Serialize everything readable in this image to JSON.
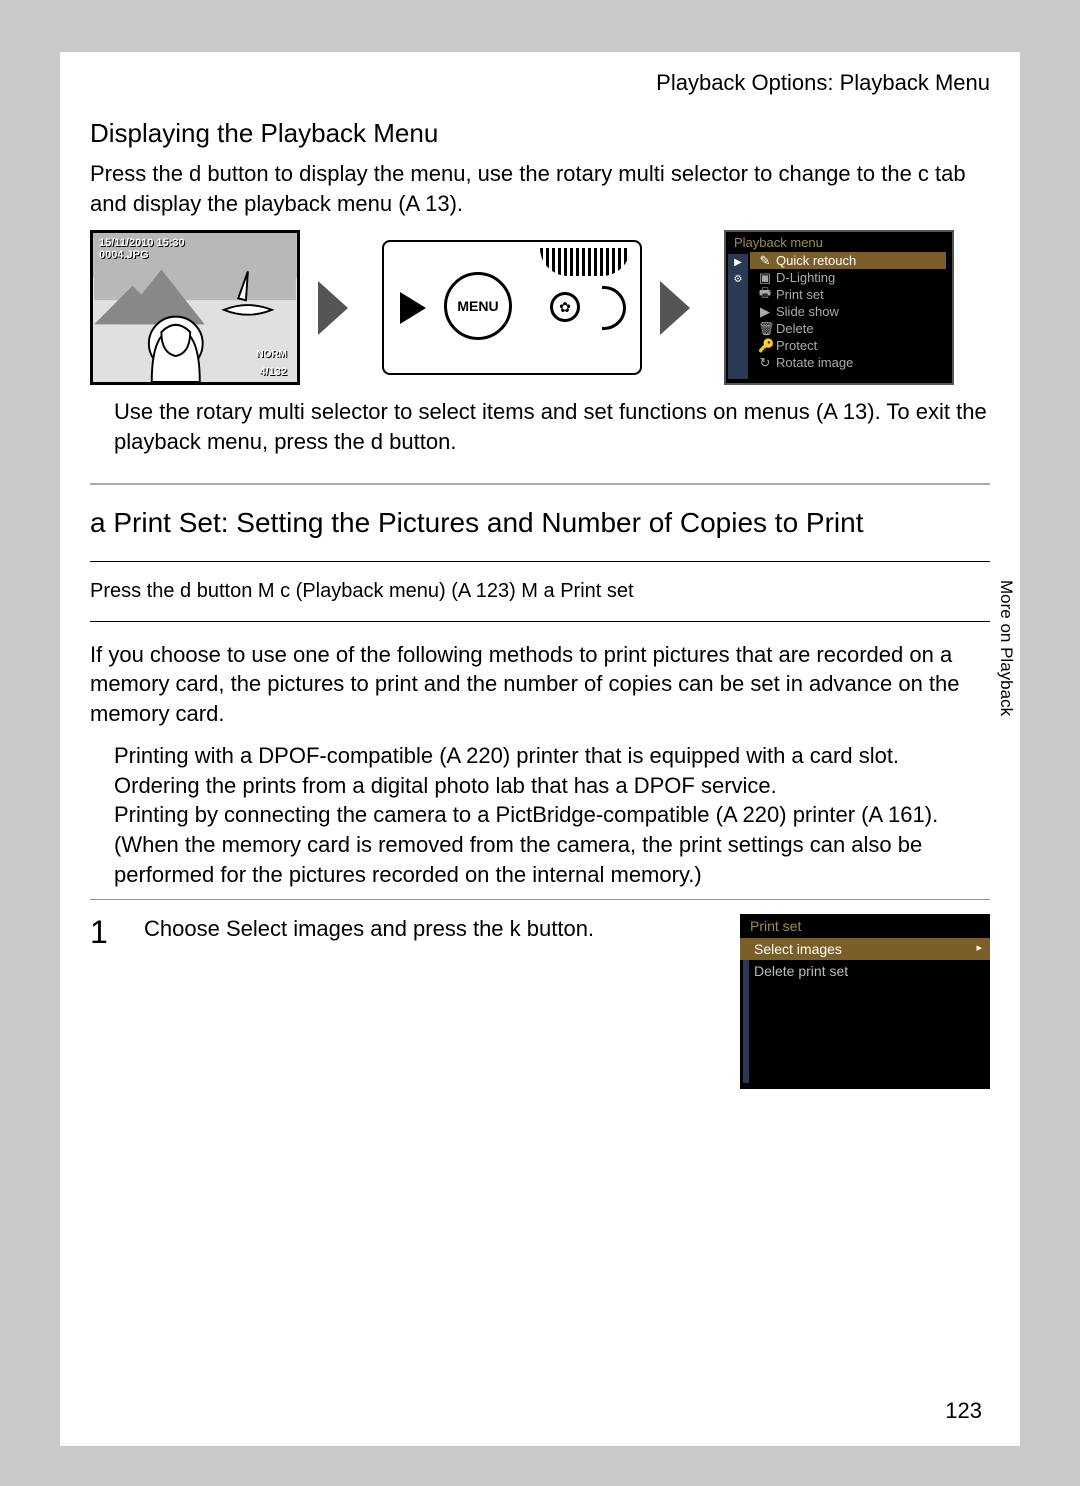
{
  "header": {
    "path": "Playback Options: Playback Menu"
  },
  "section1": {
    "title": "Displaying the Playback Menu",
    "p1": "Press the d button to display the menu, use the rotary multi selector to change to the c tab and display the playback menu (A 13).",
    "p2": "Use the rotary multi selector to select items and set functions on menus (A 13). To exit the playback menu, press the d button."
  },
  "illus1": {
    "timestamp": "15/11/2010 15:30",
    "filename": "0004.JPG",
    "quality": "NORM",
    "counter": "4/132"
  },
  "illus2": {
    "menu_label": "MENU"
  },
  "playback_menu_screen": {
    "title": "Playback menu",
    "items": [
      {
        "icon": "✎",
        "label": "Quick retouch",
        "selected": true
      },
      {
        "icon": "▣",
        "label": "D-Lighting"
      },
      {
        "icon": "🖶",
        "label": "Print set"
      },
      {
        "icon": "▶",
        "label": "Slide show"
      },
      {
        "icon": "🗑",
        "label": "Delete"
      },
      {
        "icon": "🔑",
        "label": "Protect"
      },
      {
        "icon": "↻",
        "label": "Rotate image"
      }
    ]
  },
  "main": {
    "heading": "a Print Set: Setting the Pictures and Number of Copies to Print",
    "breadcrumb": "Press the d button M c (Playback menu) (A 123) M a Print set",
    "p1": "If you choose to use one of the following methods to print pictures that are recorded on a memory card, the pictures to print and the number of copies can be set in advance on the memory card.",
    "b1": "Printing with a DPOF-compatible (A 220) printer that is equipped with a card slot.",
    "b2": "Ordering the prints from a digital photo lab that has a DPOF service.",
    "b3": "Printing by connecting the camera to a PictBridge-compatible (A 220) printer (A 161). (When the memory card is removed from the camera, the print settings can also be performed for the pictures recorded on the internal memory.)"
  },
  "step1": {
    "num": "1",
    "text": "Choose Select images and press the k button."
  },
  "printset_screen": {
    "title": "Print set",
    "items": [
      {
        "label": "Select images",
        "selected": true
      },
      {
        "label": "Delete print set"
      }
    ]
  },
  "side_tab": "More on Playback",
  "page_number": "123"
}
